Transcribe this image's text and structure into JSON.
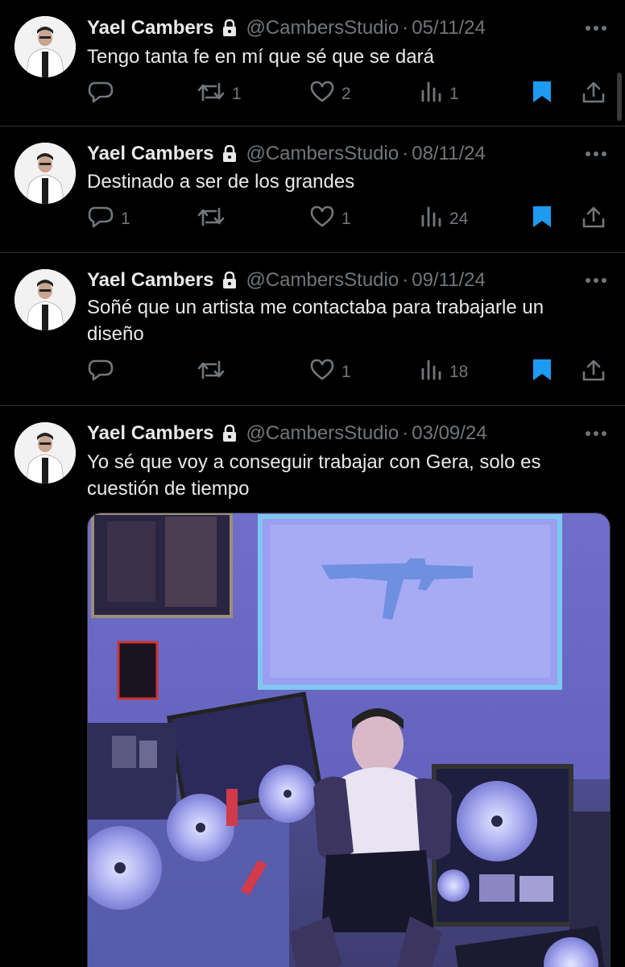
{
  "tweets": [
    {
      "author": "Yael Cambers",
      "handle": "@CambersStudio",
      "separator": "·",
      "date": "05/11/24",
      "text": "Tengo tanta fe en mí que sé que se dará",
      "replies": "",
      "retweets": "1",
      "likes": "2",
      "views": "1"
    },
    {
      "author": "Yael Cambers",
      "handle": "@CambersStudio",
      "separator": "·",
      "date": "08/11/24",
      "text": "Destinado a ser de los grandes",
      "replies": "1",
      "retweets": "",
      "likes": "1",
      "views": "24"
    },
    {
      "author": "Yael Cambers",
      "handle": "@CambersStudio",
      "separator": "·",
      "date": "09/11/24",
      "text": "Soñé que un artista me contactaba para trabajarle un diseño",
      "replies": "",
      "retweets": "",
      "likes": "1",
      "views": "18"
    },
    {
      "author": "Yael Cambers",
      "handle": "@CambersStudio",
      "separator": "·",
      "date": "03/09/24",
      "text": "Yo sé que voy a conseguir trabajar con Gera, solo es cuestión de tiempo"
    }
  ],
  "icons": {
    "lock": "lock-icon",
    "more": "more-icon",
    "reply": "reply-icon",
    "retweet": "retweet-icon",
    "like": "like-icon",
    "views": "views-icon",
    "bookmark": "bookmark-icon",
    "share": "share-icon"
  },
  "colors": {
    "background": "#000000",
    "text": "#e7e9ea",
    "muted": "#71767b",
    "bookmark_active": "#1d9bf0",
    "divider": "#2f3336"
  }
}
